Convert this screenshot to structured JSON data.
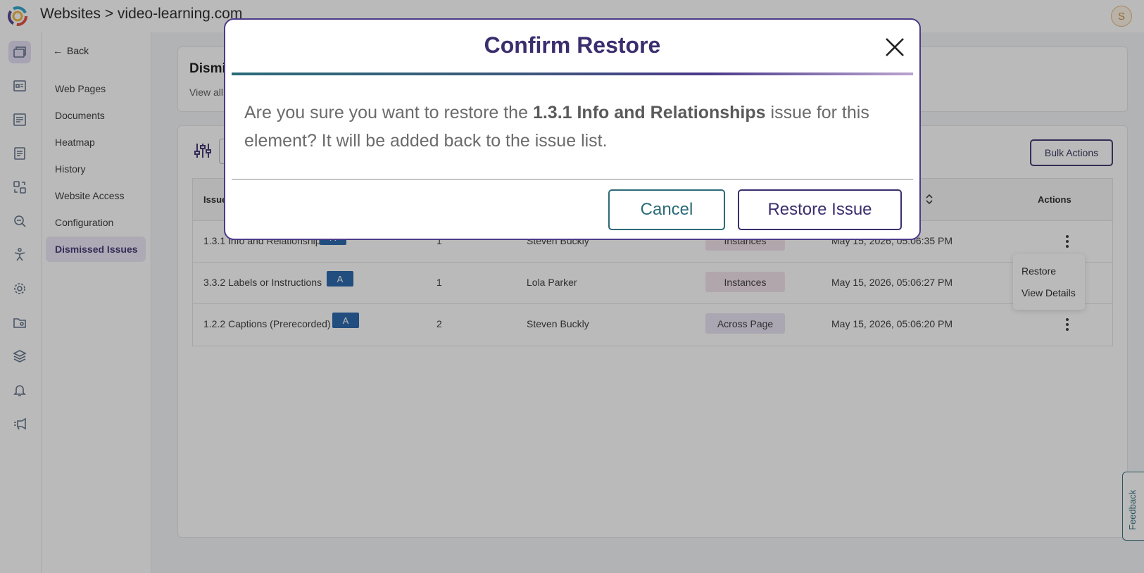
{
  "header": {
    "title": "Websites > video-learning.com",
    "avatar_initial": "S"
  },
  "rail": {
    "icons": [
      "websites-icon",
      "dashboard-icon",
      "reports-icon",
      "document-icon",
      "scan-icon",
      "search-icon",
      "accessibility-icon",
      "settings-icon",
      "folder-settings-icon",
      "layers-icon",
      "bell-icon",
      "announcement-icon"
    ]
  },
  "subnav": {
    "back_label": "Back",
    "items": [
      {
        "label": "Web Pages"
      },
      {
        "label": "Documents"
      },
      {
        "label": "Heatmap"
      },
      {
        "label": "History"
      },
      {
        "label": "Website Access"
      },
      {
        "label": "Configuration"
      },
      {
        "label": "Dismissed Issues"
      }
    ]
  },
  "page": {
    "title_partial": "Dismi",
    "subtitle_partial": "View all"
  },
  "toolbar": {
    "bulk_actions_label": "Bulk Actions"
  },
  "table": {
    "headers": {
      "issue": "Issue",
      "actions": "Actions"
    },
    "rows": [
      {
        "issue": "1.3.1 Info and Relationships",
        "level": "A",
        "count": "1",
        "user": "Steven Buckly",
        "scope": "Instances",
        "date": "May 15, 2026, 05:06:35 PM"
      },
      {
        "issue": "3.3.2 Labels or Instructions",
        "level": "A",
        "count": "1",
        "user": "Lola Parker",
        "scope": "Instances",
        "date": "May 15, 2026, 05:06:27 PM"
      },
      {
        "issue": "1.2.2 Captions (Prerecorded)",
        "level": "A",
        "count": "2",
        "user": "Steven Buckly",
        "scope": "Across Page",
        "date": "May 15, 2026, 05:06:20 PM"
      }
    ]
  },
  "row_menu": {
    "restore_label": "Restore",
    "view_details_label": "View Details"
  },
  "feedback_label": "Feedback",
  "modal": {
    "title": "Confirm Restore",
    "body_prefix": "Are you sure you want to restore the ",
    "body_issue": "1.3.1 Info and Relationships",
    "body_suffix": " issue for this element? It will be added back to the issue list.",
    "cancel_label": "Cancel",
    "restore_label": "Restore Issue"
  },
  "colors": {
    "brand_purple": "#3b2e6e",
    "teal": "#2c6b78",
    "level_blue": "#1e5fa8"
  }
}
